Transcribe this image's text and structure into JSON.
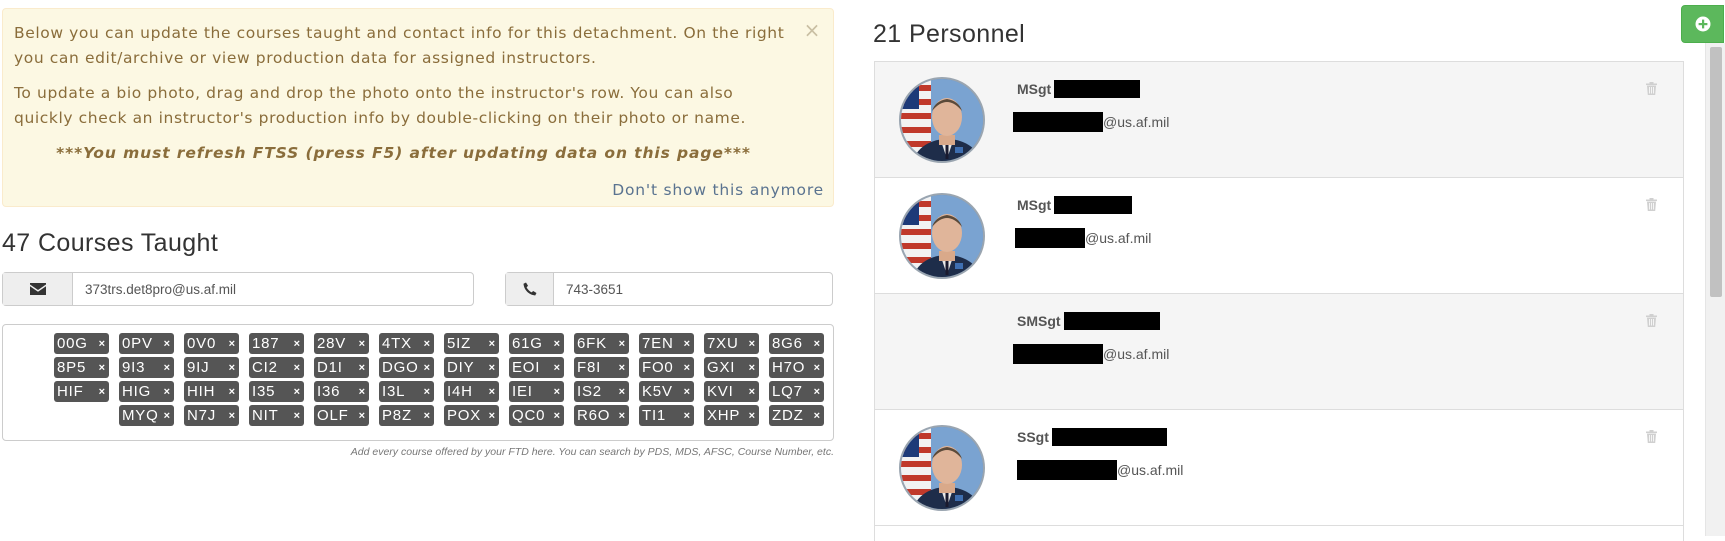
{
  "alert": {
    "close_symbol": "×",
    "paragraph1": "Below you can update the courses taught and contact info for this detachment. On the right you can edit/archive or view production data for assigned instructors.",
    "paragraph2": "To update a bio photo, drag and drop the photo onto the instructor's row. You can also quickly check an instructor's production info by double-clicking on their photo or name.",
    "warning": "***You must refresh FTSS (press F5) after updating data on this page***",
    "dismiss_label": "Don't show this anymore"
  },
  "courses": {
    "title": "47 Courses Taught",
    "email_value": "373trs.det8pro@us.af.mil",
    "email_icon": "envelope-icon",
    "phone_value": "743-3651",
    "phone_icon": "phone-icon",
    "tag_remove_symbol": "×",
    "tag_rows": [
      [
        "00G",
        "0PV",
        "0V0",
        "187",
        "28V",
        "4TX",
        "5IZ",
        "61G",
        "6FK",
        "7EN",
        "7XU",
        "8G6"
      ],
      [
        "8P5",
        "9I3",
        "9IJ",
        "CI2",
        "D1I",
        "DGO",
        "DIY",
        "EOI",
        "F8I",
        "FO0",
        "GXI",
        "H7O"
      ],
      [
        "HIF",
        "HIG",
        "HIH",
        "I35",
        "I36",
        "I3L",
        "I4H",
        "IEI",
        "IS2",
        "K5V",
        "KVI",
        "LQ7"
      ],
      [
        "MYQ",
        "N7J",
        "NIT",
        "OLF",
        "P8Z",
        "POX",
        "QC0",
        "R6O",
        "TI1",
        "XHP",
        "ZDZ"
      ]
    ],
    "help_text": "Add every course offered by your FTD here. You can search by PDS, MDS, AFSC, Course Number, etc."
  },
  "personnel": {
    "title": "21 Personnel",
    "add_icon": "plus-circle-icon",
    "trash_icon": "trash-icon",
    "items": [
      {
        "rank": "MSgt",
        "email_suffix": "@us.af.mil",
        "has_photo": true
      },
      {
        "rank": "MSgt",
        "email_suffix": "@us.af.mil",
        "has_photo": true
      },
      {
        "rank": "SMSgt",
        "email_suffix": "@us.af.mil",
        "has_photo": false
      },
      {
        "rank": "SSgt",
        "email_suffix": "@us.af.mil",
        "has_photo": true
      }
    ]
  },
  "colors": {
    "alert_bg": "#fcf8e3",
    "alert_text": "#8a6d3b",
    "tag_bg": "#555555",
    "add_button": "#5cb85c"
  }
}
